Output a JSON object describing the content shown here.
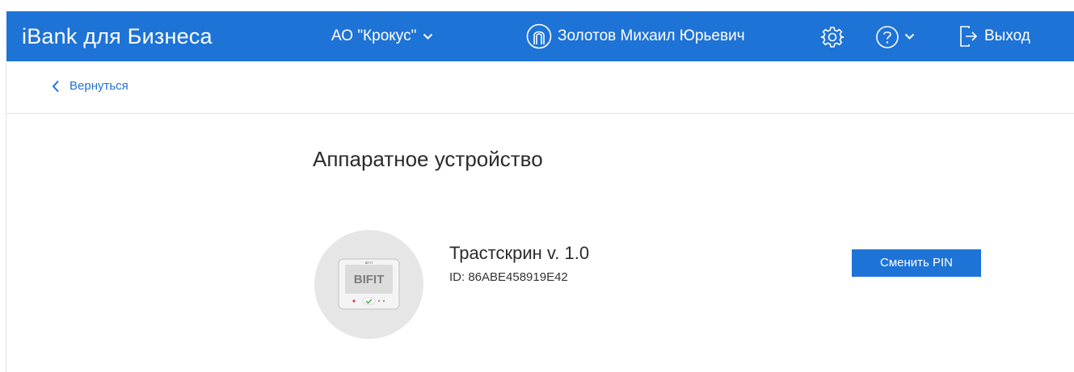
{
  "header": {
    "brand": "iBank для Бизнеса",
    "organization": "АО \"Крокус\"",
    "user_name": "Золотов Михаил Юрьевич",
    "logout_label": "Выход",
    "icons": {
      "org_dropdown": "chevron-down-icon",
      "user": "user-profile-icon",
      "settings": "gear-icon",
      "help": "question-circle-icon",
      "help_dropdown": "chevron-down-icon",
      "logout": "logout-icon"
    }
  },
  "nav": {
    "back_label": "Вернуться",
    "back_icon": "chevron-left-icon"
  },
  "main": {
    "title": "Аппаратное устройство",
    "device": {
      "name": "Трастскрин v. 1.0",
      "id_text": "ID: 86ABE458919E42",
      "image_brand_text": "BIFIT",
      "image_top_text": "BIFIT"
    },
    "change_pin_label": "Сменить PIN"
  },
  "colors": {
    "accent": "#1e73d6",
    "background": "#ffffff",
    "divider": "#e1e1e1",
    "text": "#2b2b2b"
  }
}
